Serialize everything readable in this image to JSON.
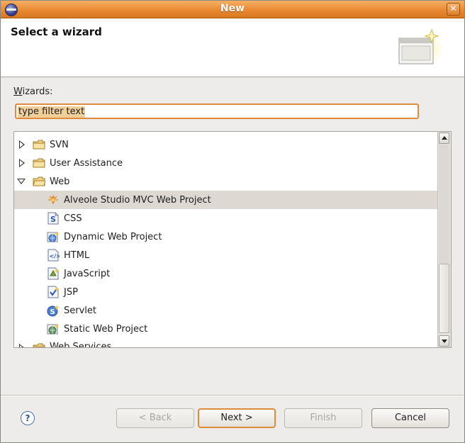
{
  "window": {
    "title": "New"
  },
  "banner": {
    "title": "Select a wizard"
  },
  "wizards": {
    "label_underlined": "W",
    "label_rest": "izards:",
    "filter_value": "type filter text"
  },
  "tree": {
    "items": [
      {
        "label": "SVN",
        "type": "folder",
        "state": "collapsed",
        "icon": "folder-icon"
      },
      {
        "label": "User Assistance",
        "type": "folder",
        "state": "collapsed",
        "icon": "folder-icon"
      },
      {
        "label": "Web",
        "type": "folder",
        "state": "expanded",
        "icon": "folder-icon"
      },
      {
        "label": "Alveole Studio MVC Web Project",
        "type": "wizard",
        "icon": "alveole-icon",
        "selected": true
      },
      {
        "label": "CSS",
        "type": "wizard",
        "icon": "css-file-icon"
      },
      {
        "label": "Dynamic Web Project",
        "type": "wizard",
        "icon": "dynamic-web-project-icon"
      },
      {
        "label": "HTML",
        "type": "wizard",
        "icon": "html-file-icon"
      },
      {
        "label": "JavaScript",
        "type": "wizard",
        "icon": "javascript-file-icon"
      },
      {
        "label": "JSP",
        "type": "wizard",
        "icon": "jsp-file-icon"
      },
      {
        "label": "Servlet",
        "type": "wizard",
        "icon": "servlet-icon"
      },
      {
        "label": "Static Web Project",
        "type": "wizard",
        "icon": "static-web-project-icon"
      },
      {
        "label": "Web Services",
        "type": "folder",
        "state": "collapsed",
        "icon": "folder-icon",
        "partial": true
      }
    ]
  },
  "buttons": {
    "help": "?",
    "back": "< Back",
    "next": "Next >",
    "finish": "Finish",
    "cancel": "Cancel"
  }
}
